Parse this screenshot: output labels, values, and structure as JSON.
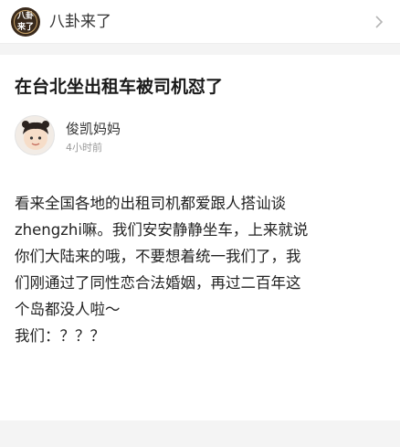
{
  "header": {
    "channel_avatar_text": "八卦来了",
    "channel_name": "八卦来了",
    "chevron_icon": "chevron-right-icon"
  },
  "post": {
    "title": "在台北坐出租车被司机怼了",
    "author": {
      "name": "俊凯妈妈",
      "time": "4小时前",
      "avatar_icon": "user-avatar"
    },
    "body_lines": [
      "看来全国各地的出租司机都爱跟人搭讪谈",
      "zhengzhi嘛。我们安安静静坐车，上来就说",
      "你们大陆来的哦，不要想着统一我们了，我",
      "们刚通过了同性恋合法婚姻，再过二百年这",
      "个岛都没人啦～",
      "我们：？？？"
    ]
  },
  "colors": {
    "background": "#ffffff",
    "band": "#f4f4f4",
    "text": "#222222",
    "muted": "#999999"
  }
}
